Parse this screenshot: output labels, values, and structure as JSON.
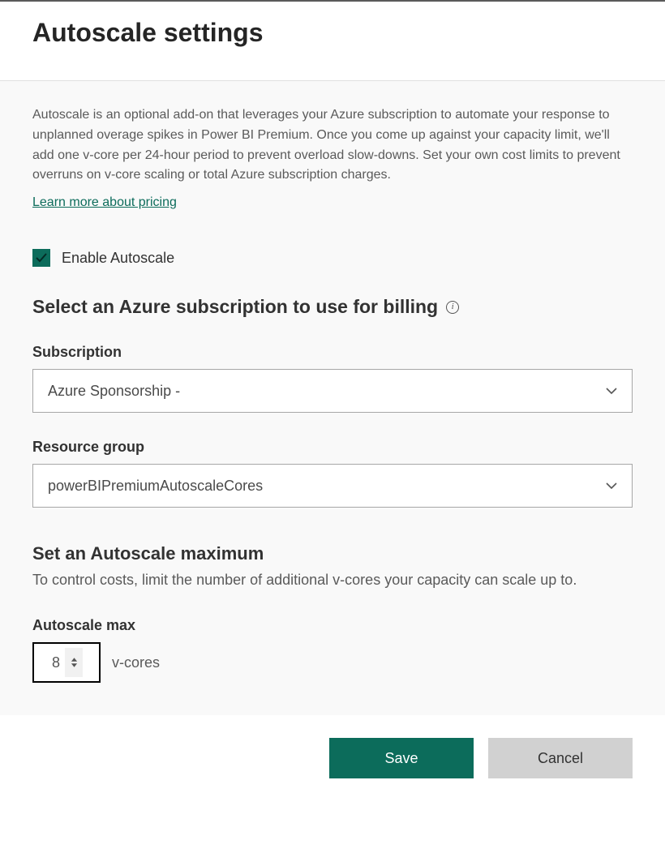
{
  "header": {
    "title": "Autoscale settings"
  },
  "intro": {
    "text": "Autoscale is an optional add-on that leverages your Azure subscription to automate your response to unplanned overage spikes in Power BI Premium. Once you come up against your capacity limit, we'll add one v-core per 24-hour period to prevent overload slow-downs. Set your own cost limits to prevent overruns on v-core scaling or total Azure subscription charges.",
    "link_label": "Learn more about pricing"
  },
  "enable": {
    "label": "Enable Autoscale",
    "checked": true
  },
  "billing": {
    "heading": "Select an Azure subscription to use for billing",
    "subscription": {
      "label": "Subscription",
      "value": "Azure Sponsorship -"
    },
    "resource_group": {
      "label": "Resource group",
      "value": "powerBIPremiumAutoscaleCores"
    }
  },
  "maximum": {
    "heading": "Set an Autoscale maximum",
    "description": "To control costs, limit the number of additional v-cores your capacity can scale up to.",
    "field_label": "Autoscale max",
    "value": "8",
    "unit": "v-cores"
  },
  "footer": {
    "save": "Save",
    "cancel": "Cancel"
  }
}
